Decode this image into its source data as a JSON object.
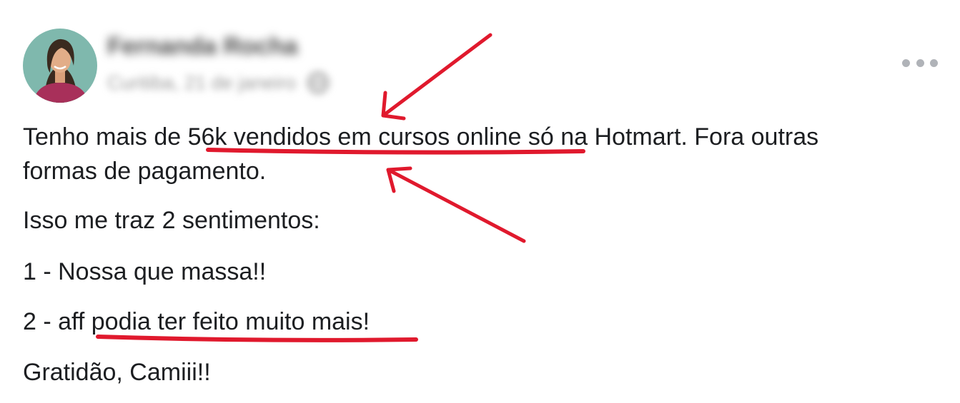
{
  "post": {
    "author_name": "Fernanda Rocha",
    "meta_text": "Curitiba, 21 de janeiro",
    "privacy_icon": "globe-icon",
    "more_icon": "more-options-icon",
    "body": {
      "line1": {
        "before": "Tenho mais de ",
        "highlight": "56k vendidos em cursos online",
        "after": " só na Hotmart. Fora outras"
      },
      "line2": "formas de pagamento.",
      "line3": "Isso me traz 2 sentimentos:",
      "line4": "1 - Nossa que massa!!",
      "line5": {
        "before": "2 - aff ",
        "highlight": "podia ter feito muito mais!"
      },
      "line6": "Gratidão, Camiii!!"
    }
  },
  "colors": {
    "annotation": "#e0192d",
    "text": "#1c1e21",
    "muted": "#b0b3b8"
  }
}
